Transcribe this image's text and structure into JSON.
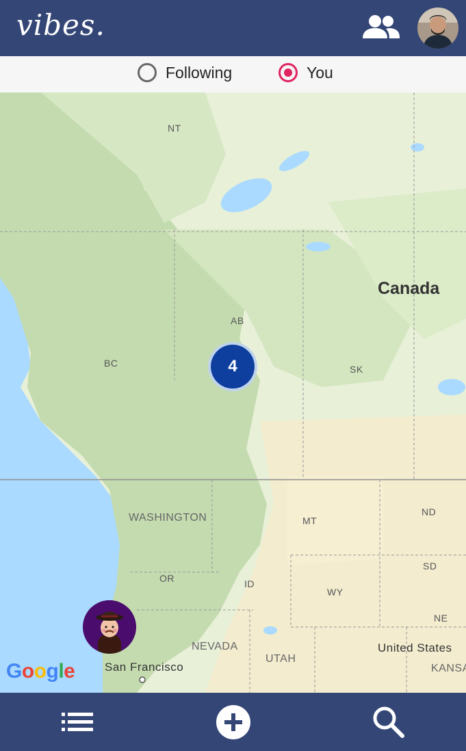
{
  "header": {
    "logo_text": "vibes.",
    "friends_icon": "people-icon",
    "avatar_icon": "user-avatar"
  },
  "toggle": {
    "options": [
      {
        "label": "Following",
        "selected": false
      },
      {
        "label": "You",
        "selected": true
      }
    ],
    "accent_color": "#e0245e"
  },
  "map": {
    "labels": {
      "nt": "NT",
      "canada": "Canada",
      "ab": "AB",
      "bc": "BC",
      "sk": "SK",
      "washington": "WASHINGTON",
      "mt": "MT",
      "nd": "ND",
      "or": "OR",
      "id": "ID",
      "wy": "WY",
      "sd": "SD",
      "ne": "NE",
      "nevada": "NEVADA",
      "utah": "UTAH",
      "united_states": "United States",
      "kansas": "KANSA",
      "san_francisco": "San Francisco"
    },
    "cluster_count": "4",
    "attribution": "Google"
  },
  "bottom_nav": {
    "list_icon": "list-icon",
    "add_icon": "add-icon",
    "search_icon": "search-icon"
  },
  "colors": {
    "brand": "#344676",
    "cluster": "#0e3f9e",
    "water": "#aadaff",
    "land": "#e8f0d8"
  }
}
